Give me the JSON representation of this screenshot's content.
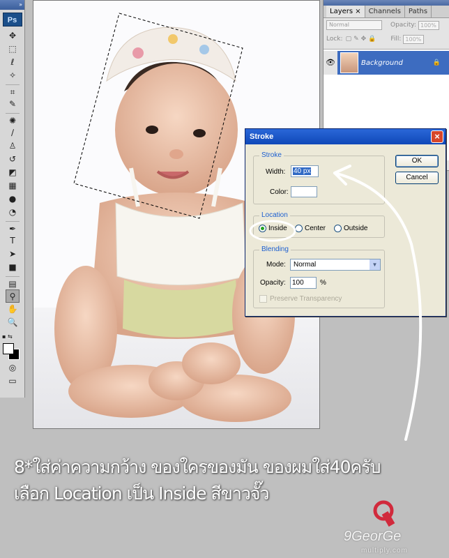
{
  "toolbox": {
    "logo": "Ps"
  },
  "layers": {
    "tabs": [
      "Layers ×",
      "Channels",
      "Paths"
    ],
    "blend_mode": "Normal",
    "opacity_label": "Opacity:",
    "opacity_value": "100%",
    "lock_label": "Lock:",
    "fill_label": "Fill:",
    "fill_value": "100%",
    "layer_name": "Background"
  },
  "dialog": {
    "title": "Stroke",
    "stroke_group": "Stroke",
    "width_label": "Width:",
    "width_value": "40 px",
    "color_label": "Color:",
    "location_group": "Location",
    "location_options": [
      "Inside",
      "Center",
      "Outside"
    ],
    "location_selected": "Inside",
    "blending_group": "Blending",
    "mode_label": "Mode:",
    "mode_value": "Normal",
    "opacity_label": "Opacity:",
    "opacity_value": "100",
    "opacity_unit": "%",
    "preserve_label": "Preserve Transparency",
    "ok_label": "OK",
    "cancel_label": "Cancel"
  },
  "caption": {
    "line1": "8*ใส่ค่าความกว้าง ของใครของมัน ของผมใส่40ครับ",
    "line2": "เลือก Location เป็น Inside สีขาวจั๊ว"
  },
  "watermark": {
    "name": "9GeorGe",
    "site": "multiply.com"
  },
  "colors": {
    "accent": "#3d6cc0",
    "dialog_bg": "#ece9d8",
    "title_bar": "#0f48b8"
  }
}
